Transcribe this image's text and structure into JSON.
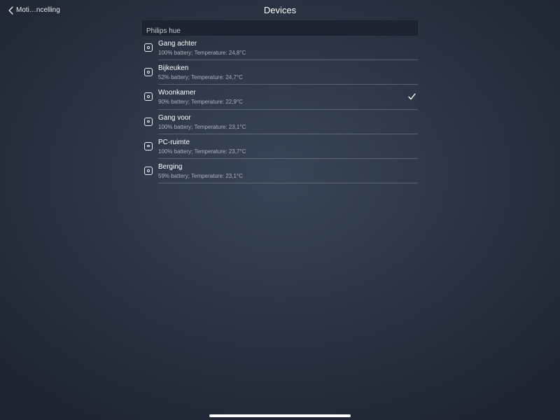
{
  "nav": {
    "back_label": "Moti…ncelling",
    "title": "Devices"
  },
  "section": {
    "title": "Philips hue"
  },
  "devices": [
    {
      "name": "Gang achter",
      "details": "100% battery; Temperature: 24,8°C",
      "selected": false,
      "icon": "sensor-icon"
    },
    {
      "name": "Bijkeuken",
      "details": "52% battery; Temperature: 24,7°C",
      "selected": false,
      "icon": "sensor-icon"
    },
    {
      "name": "Woonkamer",
      "details": "90% battery; Temperature: 22,9°C",
      "selected": true,
      "icon": "sensor-icon"
    },
    {
      "name": "Gang voor",
      "details": "100% battery; Temperature: 23,1°C",
      "selected": false,
      "icon": "sensor-icon"
    },
    {
      "name": "PC-ruimte",
      "details": "100% battery; Temperature: 23,7°C",
      "selected": false,
      "icon": "sensor-icon"
    },
    {
      "name": "Berging",
      "details": "59% battery; Temperature: 23,1°C",
      "selected": false,
      "icon": "sensor-icon"
    }
  ],
  "colors": {
    "text": "#ffffff",
    "secondary_text": "#aab1bc",
    "section_background": "#1d2330"
  }
}
